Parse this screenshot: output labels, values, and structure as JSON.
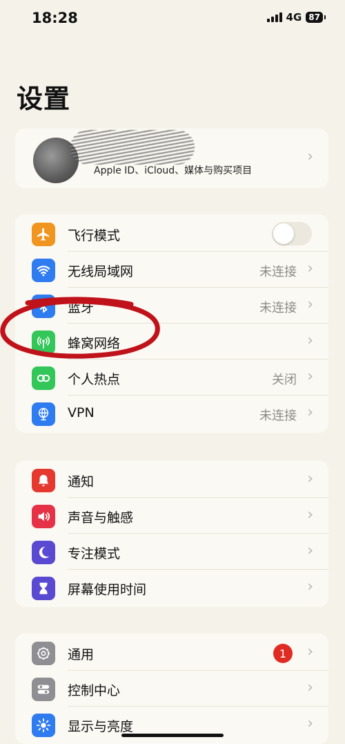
{
  "status": {
    "time": "18:28",
    "network": "4G",
    "battery": "87"
  },
  "title": "设置",
  "profile": {
    "subtitle": "Apple ID、iCloud、媒体与购买项目"
  },
  "groups": [
    {
      "items": [
        {
          "label": "飞行模式",
          "icon": "airplane-icon",
          "color": "#f0951f",
          "toggle": false
        },
        {
          "label": "无线局域网",
          "value": "未连接",
          "icon": "wifi-icon",
          "color": "#2f7bf0"
        },
        {
          "label": "蓝牙",
          "value": "未连接",
          "icon": "bluetooth-icon",
          "color": "#2f7bf0"
        },
        {
          "label": "蜂窝网络",
          "icon": "cellular-icon",
          "color": "#33c659"
        },
        {
          "label": "个人热点",
          "value": "关闭",
          "icon": "hotspot-icon",
          "color": "#33c659"
        },
        {
          "label": "VPN",
          "value": "未连接",
          "icon": "vpn-icon",
          "color": "#2f7bf0"
        }
      ]
    },
    {
      "items": [
        {
          "label": "通知",
          "icon": "notification-icon",
          "color": "#e5392f"
        },
        {
          "label": "声音与触感",
          "icon": "sound-icon",
          "color": "#e53246"
        },
        {
          "label": "专注模式",
          "icon": "focus-moon-icon",
          "color": "#5a4ad1"
        },
        {
          "label": "屏幕使用时间",
          "icon": "hourglass-icon",
          "color": "#5a4ad1"
        }
      ]
    },
    {
      "items": [
        {
          "label": "通用",
          "icon": "gear-icon",
          "color": "#8e8e93",
          "badge": "1"
        },
        {
          "label": "控制中心",
          "icon": "control-center-icon",
          "color": "#8e8e93"
        },
        {
          "label": "显示与亮度",
          "icon": "brightness-icon",
          "color": "#2f7bf0"
        }
      ]
    }
  ],
  "colors": {
    "annotation": "#c0121a",
    "background": "#f5f2ea"
  }
}
